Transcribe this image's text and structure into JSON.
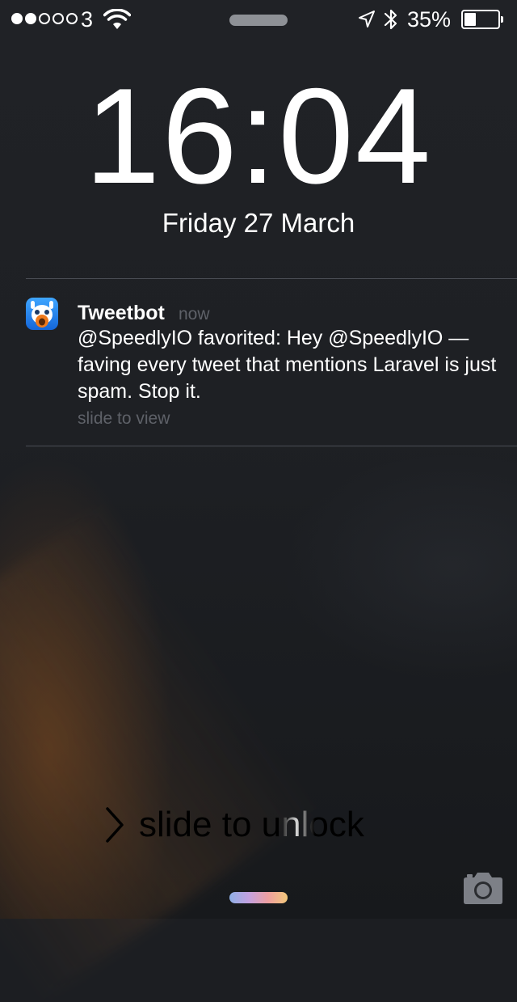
{
  "status_bar": {
    "signal_strength": 2,
    "signal_total": 5,
    "carrier": "3",
    "battery_percent": "35%",
    "battery_level": 0.35,
    "icons": [
      "wifi-icon",
      "location-icon",
      "bluetooth-icon",
      "battery-icon"
    ]
  },
  "lock_screen": {
    "time": "16:04",
    "date": "Friday 27 March"
  },
  "notification": {
    "app_name": "Tweetbot",
    "timestamp": "now",
    "message": "@SpeedlyIO favorited: Hey @SpeedlyIO — faving every tweet that mentions Laravel is just spam. Stop it.",
    "action_hint": "slide to view",
    "icon": "tweetbot-app-icon"
  },
  "unlock": {
    "label": "slide to unlock"
  },
  "colors": {
    "background": "#1c1e22",
    "secondary_text": "#5e6168",
    "divider": "#4a4d54",
    "app_icon_blue": "#1e7ff0"
  }
}
